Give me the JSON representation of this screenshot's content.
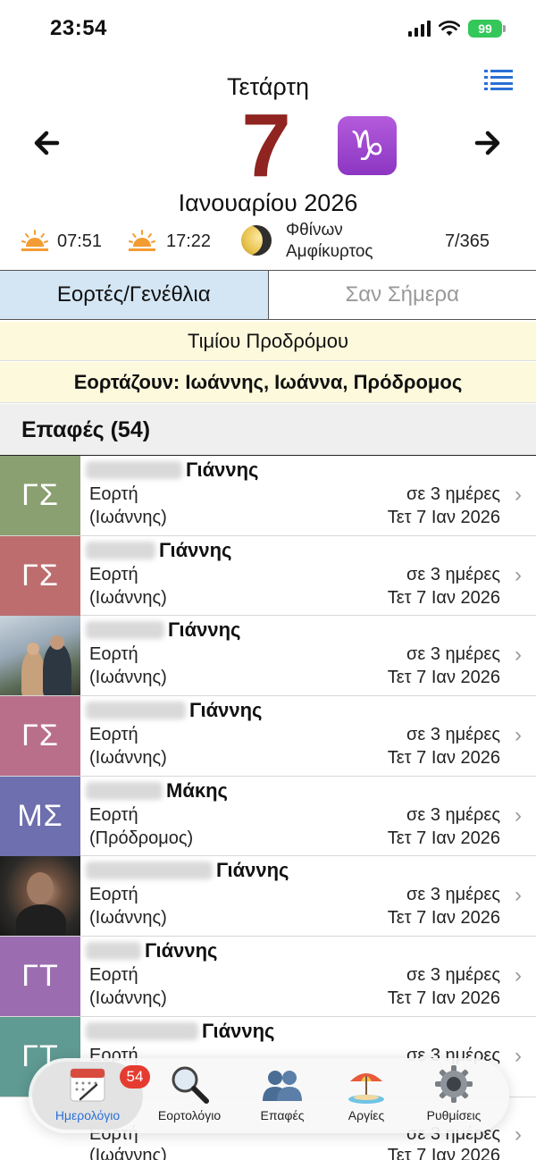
{
  "status_bar": {
    "time": "23:54",
    "battery": "99"
  },
  "header": {
    "weekday": "Τετάρτη",
    "day": "7",
    "zodiac_symbol": "♑",
    "month_year": "Ιανουαρίου 2026",
    "sunrise": "07:51",
    "sunset": "17:22",
    "moon_phase_line1": "Φθίνων",
    "moon_phase_line2": "Αμφίκυρτος",
    "day_of_year": "7/365"
  },
  "tabs": [
    {
      "label": "Εορτές/Γενέθλια",
      "active": true
    },
    {
      "label": "Σαν Σήμερα",
      "active": false
    }
  ],
  "feast": {
    "name": "Τιμίου Προδρόμου",
    "celebrants": "Εορτάζουν: Ιωάννης, Ιωάννα, Πρόδρομος"
  },
  "contacts_header": "Επαφές (54)",
  "contacts": [
    {
      "initials": "ΓΣ",
      "avatar_color": "#8aa070",
      "first_name": "Γιάννης",
      "type": "Εορτή",
      "nameday": "(Ιωάννης)",
      "days": "σε 3 ημέρες",
      "date": "Τετ 7 Ιαν 2026"
    },
    {
      "initials": "ΓΣ",
      "avatar_color": "#bd6d6d",
      "first_name": "Γιάννης",
      "type": "Εορτή",
      "nameday": "(Ιωάννης)",
      "days": "σε 3 ημέρες",
      "date": "Τετ 7 Ιαν 2026"
    },
    {
      "initials": "",
      "avatar_color": "",
      "first_name": "Γιάννης",
      "type": "Εορτή",
      "nameday": "(Ιωάννης)",
      "days": "σε 3 ημέρες",
      "date": "Τετ 7 Ιαν 2026"
    },
    {
      "initials": "ΓΣ",
      "avatar_color": "#b96f8a",
      "first_name": "Γιάννης",
      "type": "Εορτή",
      "nameday": "(Ιωάννης)",
      "days": "σε 3 ημέρες",
      "date": "Τετ 7 Ιαν 2026"
    },
    {
      "initials": "ΜΣ",
      "avatar_color": "#6d6fae",
      "first_name": "Μάκης",
      "type": "Εορτή",
      "nameday": "(Πρόδρομος)",
      "days": "σε 3 ημέρες",
      "date": "Τετ 7 Ιαν 2026"
    },
    {
      "initials": "",
      "avatar_color": "",
      "first_name": "Γιάννης",
      "type": "Εορτή",
      "nameday": "(Ιωάννης)",
      "days": "σε 3 ημέρες",
      "date": "Τετ 7 Ιαν 2026"
    },
    {
      "initials": "ΓΤ",
      "avatar_color": "#9b6db0",
      "first_name": "Γιάννης",
      "type": "Εορτή",
      "nameday": "(Ιωάννης)",
      "days": "σε 3 ημέρες",
      "date": "Τετ 7 Ιαν 2026"
    },
    {
      "initials": "ΓΤ",
      "avatar_color": "#5f9a93",
      "first_name": "Γιάννης",
      "type": "Εορτή",
      "nameday": "",
      "days": "σε 3 ημέρες",
      "date": ""
    }
  ],
  "peek_row": {
    "type": "Εορτή",
    "nameday": "(Ιωάννης)",
    "days": "σε 3 ημέρες",
    "date": "Τετ 7 Ιαν 2026"
  },
  "tab_bar": {
    "badge": "54",
    "items": [
      {
        "label": "Ημερολόγιο",
        "icon": "calendar-icon",
        "active": true
      },
      {
        "label": "Εορτολόγιο",
        "icon": "magnifier-icon",
        "active": false
      },
      {
        "label": "Επαφές",
        "icon": "people-icon",
        "active": false
      },
      {
        "label": "Αργίες",
        "icon": "beach-umbrella-icon",
        "active": false
      },
      {
        "label": "Ρυθμίσεις",
        "icon": "gear-icon",
        "active": false
      }
    ]
  },
  "colors": {
    "accent": "#2a6fd6",
    "day_number": "#8f2420",
    "tab_active_bg": "#d4e6f4",
    "feast_bg": "#fdf9dc",
    "badge": "#e53b30"
  }
}
